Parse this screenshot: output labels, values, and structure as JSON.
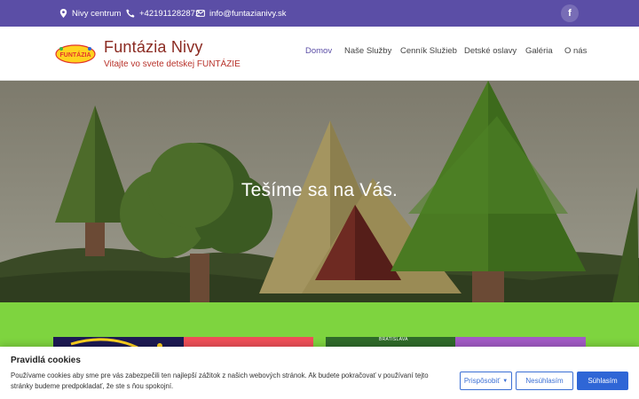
{
  "topbar": {
    "location": "Nivy centrum",
    "phone": "+421911282872",
    "email": "info@funtazianivy.sk",
    "social_icon": "f"
  },
  "header": {
    "logo_text": "FUNTÁZIA",
    "title": "Funtázia Nivy",
    "subtitle": "Vitajte vo svete detskej FUNTÁZIE"
  },
  "nav": {
    "items": [
      {
        "label": "Domov"
      },
      {
        "label": "Naše Služby"
      },
      {
        "label": "Cenník Služieb"
      },
      {
        "label": "Detské oslavy"
      },
      {
        "label": "Galéria"
      },
      {
        "label": "O nás"
      }
    ]
  },
  "hero": {
    "headline": "Tešíme sa na Vás."
  },
  "cards": {
    "right_tag": "BRATISLAVA"
  },
  "cookie": {
    "title": "Pravidlá cookies",
    "text": "Používame cookies aby sme pre vás zabezpečili ten najlepší zážitok z našich webových stránok. Ak budete pokračovať v používaní tejto stránky budeme predpokladať, že ste s ňou spokojní.",
    "customize": "Prispôsobiť",
    "reject": "Nesúhlasím",
    "accept": "Súhlasím"
  },
  "colors": {
    "topbar": "#5b4ea6",
    "brand_title": "#8b2b22",
    "accent_green": "#7ed43f",
    "button_blue": "#2f66d6"
  }
}
